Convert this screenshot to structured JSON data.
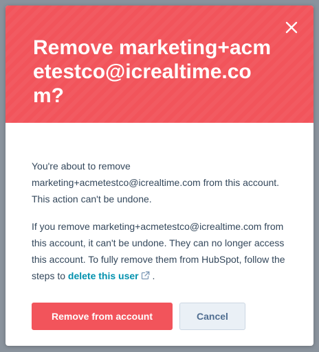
{
  "modal": {
    "title": "Remove marketing+acmetestco@icrealtime.com?",
    "close_icon": "close-icon",
    "body": {
      "paragraph1": "You're about to remove marketing+acmetestco@icrealtime.com from this account. This action can't be undone.",
      "paragraph2_text": "If you remove marketing+acmetestco@icrealtime.com from this account, it can't be undone. They can no longer access this account. To fully remove them from HubSpot, follow the steps to ",
      "paragraph2_link": "delete this user",
      "paragraph2_link_icon": "external-link-icon",
      "paragraph2_end": " ."
    },
    "buttons": {
      "remove_label": "Remove from account",
      "cancel_label": "Cancel"
    }
  },
  "colors": {
    "header": "#f2545b",
    "danger_button": "#f2545b",
    "link": "#0091ae",
    "body_text": "#33475b",
    "secondary_button_bg": "#eaf0f6",
    "secondary_button_text": "#506e91",
    "overlay": "#8a939d"
  }
}
